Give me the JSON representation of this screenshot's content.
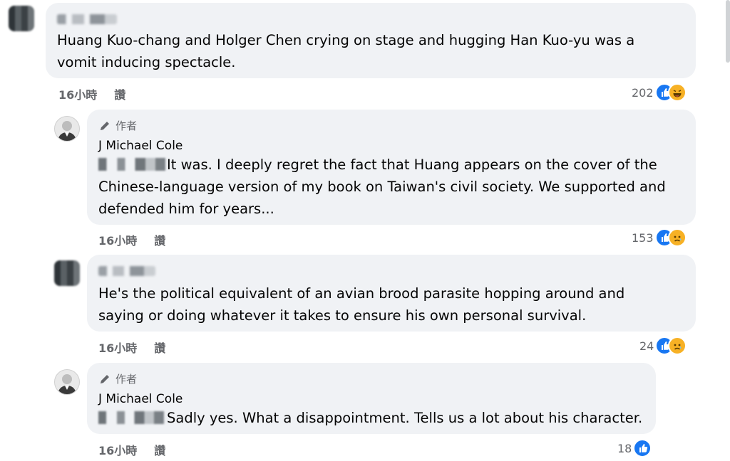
{
  "meta": {
    "time": "16小時",
    "like_action": "讚"
  },
  "author_badge": {
    "label": "作者",
    "name": "J Michael Cole"
  },
  "comments": [
    {
      "text": "Huang Kuo-chang and Holger Chen crying on stage and hugging Han Kuo-yu was a\nvomit inducing spectacle.",
      "reactions": "202",
      "reaction_types": [
        "like-icon",
        "haha-icon"
      ]
    },
    {
      "text": "It was. I deeply regret the fact that Huang appears on the cover of the\nChinese-language version of my book on Taiwan's civil society. We supported and\ndefended him for years...",
      "reactions": "153",
      "reaction_types": [
        "like-icon",
        "sad-icon"
      ]
    },
    {
      "text": "He's the political equivalent of an avian brood parasite hopping around and\nsaying or doing whatever it takes to ensure his own personal survival.",
      "reactions": "24",
      "reaction_types": [
        "like-icon",
        "sad-icon"
      ]
    },
    {
      "text": "Sadly yes. What a disappointment. Tells us a lot about his character.",
      "reactions": "18",
      "reaction_types": [
        "like-icon"
      ]
    }
  ],
  "colors": {
    "like": "#1877f2",
    "haha": "#f7b125",
    "sad": "#f7b125",
    "bubble": "#f0f2f5"
  }
}
